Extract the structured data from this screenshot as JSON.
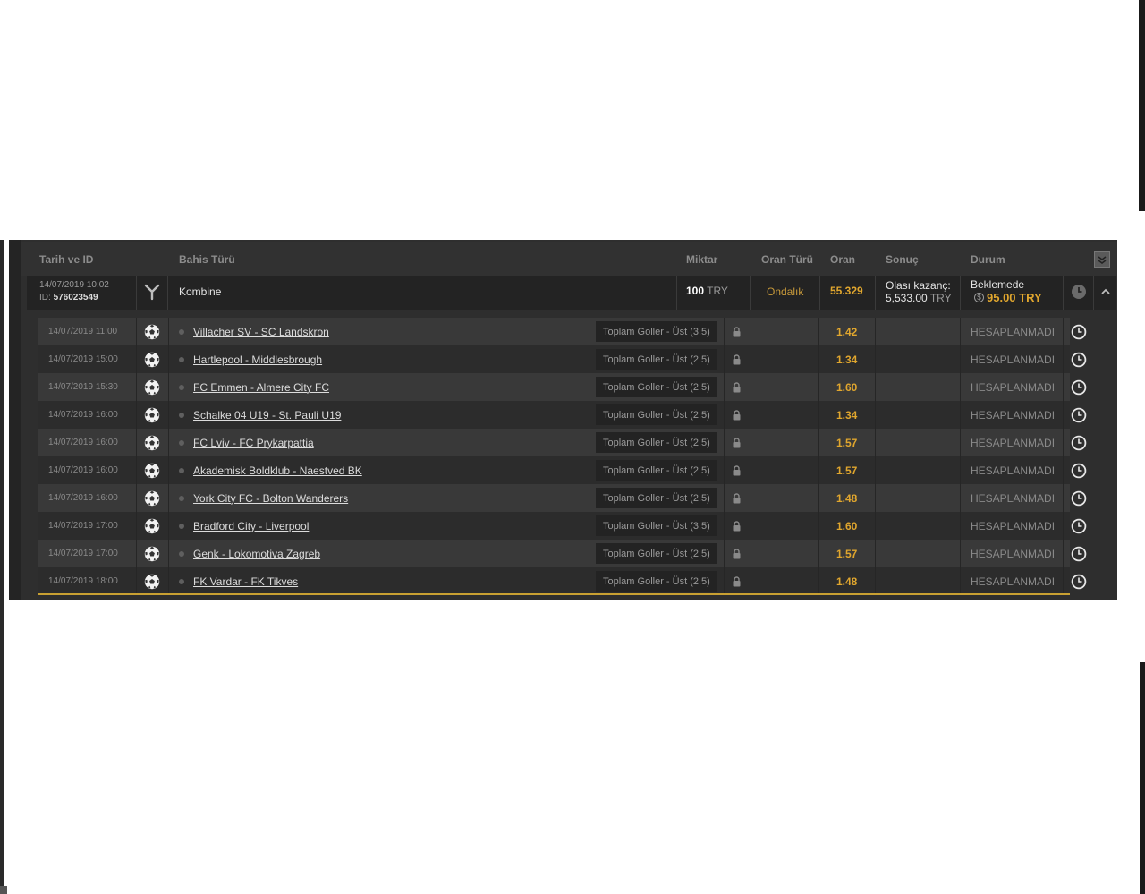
{
  "columns": {
    "date_id": "Tarih ve ID",
    "bet_type": "Bahis Türü",
    "amount": "Miktar",
    "odds_type": "Oran Türü",
    "odds": "Oran",
    "result": "Sonuç",
    "status": "Durum"
  },
  "summary": {
    "date": "14/07/2019 10:02",
    "id_label": "ID:",
    "id": "576023549",
    "bet_type": "Kombine",
    "amount": "100",
    "currency": "TRY",
    "odds_type": "Ondalık",
    "odds": "55.329",
    "potential_label": "Olası kazanç:",
    "potential_value": "5,533.00",
    "potential_currency": "TRY",
    "status": "Beklemede",
    "cashout_symbol": "$",
    "cashout": "95.00 TRY"
  },
  "selections": [
    {
      "date": "14/07/2019 11:00",
      "match": "Villacher SV - SC Landskron",
      "market": "Toplam Goller - Üst (3.5)",
      "odds": "1.42",
      "status": "HESAPLANMADI"
    },
    {
      "date": "14/07/2019 15:00",
      "match": "Hartlepool - Middlesbrough",
      "market": "Toplam Goller - Üst (2.5)",
      "odds": "1.34",
      "status": "HESAPLANMADI"
    },
    {
      "date": "14/07/2019 15:30",
      "match": "FC Emmen - Almere City FC",
      "market": "Toplam Goller - Üst (2.5)",
      "odds": "1.60",
      "status": "HESAPLANMADI"
    },
    {
      "date": "14/07/2019 16:00",
      "match": "Schalke 04 U19 - St. Pauli U19",
      "market": "Toplam Goller - Üst (2.5)",
      "odds": "1.34",
      "status": "HESAPLANMADI"
    },
    {
      "date": "14/07/2019 16:00",
      "match": "FC Lviv - FC Prykarpattia",
      "market": "Toplam Goller - Üst (2.5)",
      "odds": "1.57",
      "status": "HESAPLANMADI"
    },
    {
      "date": "14/07/2019 16:00",
      "match": "Akademisk Boldklub - Naestved BK",
      "market": "Toplam Goller - Üst (2.5)",
      "odds": "1.57",
      "status": "HESAPLANMADI"
    },
    {
      "date": "14/07/2019 16:00",
      "match": "York City FC - Bolton Wanderers",
      "market": "Toplam Goller - Üst (2.5)",
      "odds": "1.48",
      "status": "HESAPLANMADI"
    },
    {
      "date": "14/07/2019 17:00",
      "match": "Bradford City - Liverpool",
      "market": "Toplam Goller - Üst (3.5)",
      "odds": "1.60",
      "status": "HESAPLANMADI"
    },
    {
      "date": "14/07/2019 17:00",
      "match": "Genk - Lokomotiva Zagreb",
      "market": "Toplam Goller - Üst (2.5)",
      "odds": "1.57",
      "status": "HESAPLANMADI"
    },
    {
      "date": "14/07/2019 18:00",
      "match": "FK Vardar - FK Tikves",
      "market": "Toplam Goller - Üst (2.5)",
      "odds": "1.48",
      "status": "HESAPLANMADI"
    }
  ],
  "icons": {
    "bet_type": "combo-merge-icon",
    "sport": "soccer-ball-icon",
    "lock": "lock-icon",
    "clock": "clock-icon",
    "collapse": "collapse-icon",
    "chevron": "chevron-up-icon"
  },
  "colors": {
    "accent_odds": "#e0a62e",
    "odds_type": "#c89a3a",
    "panel_bg": "#2e2e2e",
    "row_light": "#393939",
    "row_dark": "#2c2c2c"
  }
}
